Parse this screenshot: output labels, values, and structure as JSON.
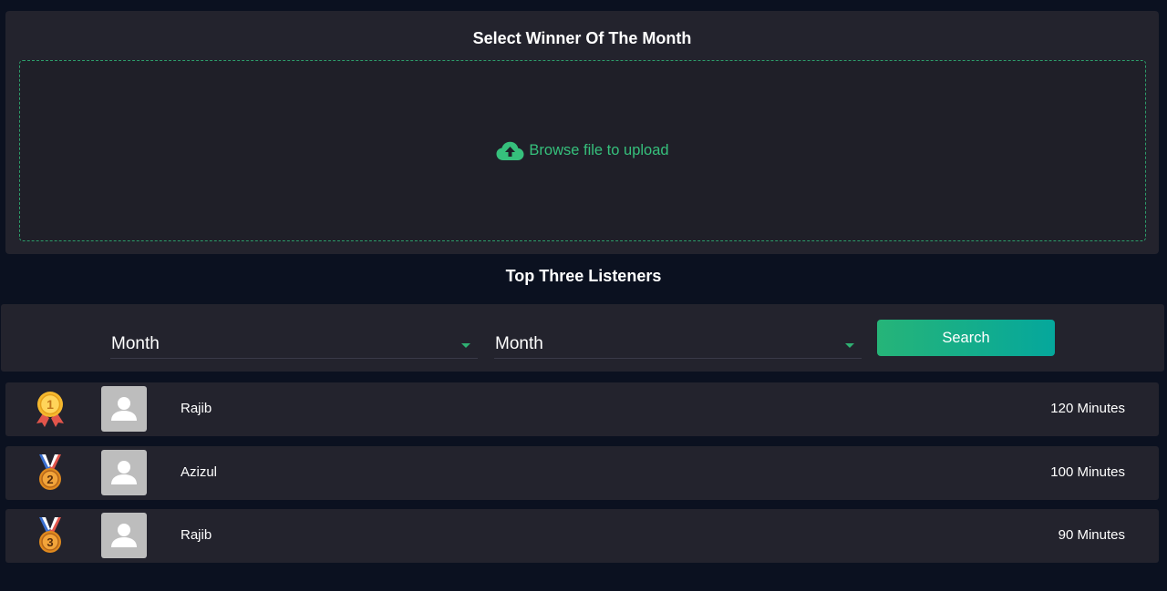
{
  "upload_section": {
    "title": "Select Winner Of The Month",
    "browse_label": "Browse file to upload",
    "icon": "cloud-upload-icon",
    "accent_color": "#36c07c"
  },
  "listeners_section": {
    "title": "Top Three Listeners",
    "filters": {
      "select_1": "Month",
      "select_2": "Month",
      "search_label": "Search"
    },
    "rows": [
      {
        "rank": "1",
        "medal_icon": "gold-medal-icon",
        "name": "Rajib",
        "minutes": "120 Minutes"
      },
      {
        "rank": "2",
        "medal_icon": "silver-medal-icon",
        "name": "Azizul",
        "minutes": "100 Minutes"
      },
      {
        "rank": "3",
        "medal_icon": "bronze-medal-icon",
        "name": "Rajib",
        "minutes": "90 Minutes"
      }
    ]
  }
}
